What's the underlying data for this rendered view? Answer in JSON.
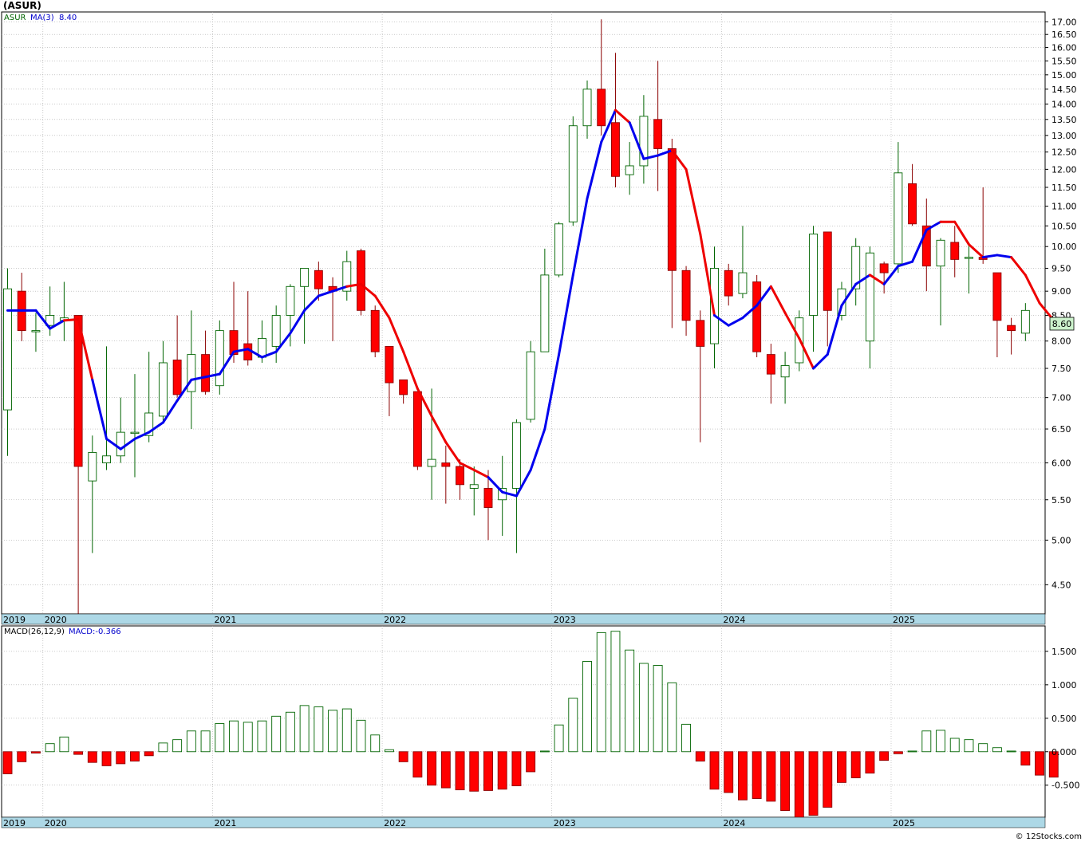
{
  "title": "(ASUR)",
  "watermark": "© 12Stocks.com",
  "price_panel": {
    "legend_symbol": "ASUR",
    "legend_ma_label": "MA(3)",
    "legend_ma_value": "8.40",
    "last_price": "8.60",
    "y_ticks": [
      "17.00",
      "16.50",
      "16.00",
      "15.50",
      "15.00",
      "14.50",
      "14.00",
      "13.50",
      "13.00",
      "12.50",
      "12.00",
      "11.50",
      "11.00",
      "10.50",
      "10.00",
      "9.50",
      "9.00",
      "8.50",
      "8.00",
      "7.50",
      "7.00",
      "6.50",
      "6.00",
      "5.50",
      "5.00",
      "4.50"
    ]
  },
  "macd_panel": {
    "legend_label": "MACD(26,12,9)",
    "legend_value": "MACD:-0.366",
    "y_ticks": [
      "1.500",
      "1.000",
      "0.500",
      "0.000",
      "-0.500"
    ]
  },
  "x_axis_labels": [
    "2019",
    "2020",
    "2021",
    "2022",
    "2023",
    "2024",
    "2025"
  ],
  "colors": {
    "up_candle": "#ffffff",
    "up_outline": "#006400",
    "down_candle": "#ff0000",
    "ma_up": "#0000ee",
    "ma_down": "#ee0000",
    "axis_band": "#add8e6",
    "grid": "#aaaaaa"
  },
  "chart_data": [
    {
      "type": "candlestick",
      "title": "(ASUR)",
      "period": "monthly",
      "scale": "log",
      "ylim": [
        4.2,
        17.4
      ],
      "start": "2019-10",
      "candles": [
        {
          "date": "2019-10",
          "o": 6.8,
          "h": 9.5,
          "l": 6.1,
          "c": 9.05
        },
        {
          "date": "2019-11",
          "o": 9.0,
          "h": 9.4,
          "l": 8.0,
          "c": 8.2
        },
        {
          "date": "2019-12",
          "o": 8.2,
          "h": 8.55,
          "l": 7.8,
          "c": 8.2
        },
        {
          "date": "2020-01",
          "o": 8.3,
          "h": 9.1,
          "l": 8.1,
          "c": 8.5
        },
        {
          "date": "2020-02",
          "o": 8.4,
          "h": 9.2,
          "l": 8.0,
          "c": 8.45
        },
        {
          "date": "2020-03",
          "o": 8.5,
          "h": 8.5,
          "l": 4.15,
          "c": 5.95
        },
        {
          "date": "2020-04",
          "o": 5.75,
          "h": 6.4,
          "l": 4.85,
          "c": 6.15
        },
        {
          "date": "2020-05",
          "o": 6.0,
          "h": 7.9,
          "l": 5.9,
          "c": 6.1
        },
        {
          "date": "2020-06",
          "o": 6.1,
          "h": 7.0,
          "l": 6.0,
          "c": 6.45
        },
        {
          "date": "2020-07",
          "o": 6.45,
          "h": 7.4,
          "l": 5.8,
          "c": 6.45
        },
        {
          "date": "2020-08",
          "o": 6.4,
          "h": 7.8,
          "l": 6.3,
          "c": 6.75
        },
        {
          "date": "2020-09",
          "o": 6.7,
          "h": 8.0,
          "l": 6.6,
          "c": 7.6
        },
        {
          "date": "2020-10",
          "o": 7.65,
          "h": 8.5,
          "l": 7.0,
          "c": 7.05
        },
        {
          "date": "2020-11",
          "o": 7.1,
          "h": 8.6,
          "l": 6.5,
          "c": 7.75
        },
        {
          "date": "2020-12",
          "o": 7.75,
          "h": 8.2,
          "l": 7.05,
          "c": 7.1
        },
        {
          "date": "2021-01",
          "o": 7.2,
          "h": 8.4,
          "l": 7.05,
          "c": 8.2
        },
        {
          "date": "2021-02",
          "o": 8.2,
          "h": 9.2,
          "l": 7.6,
          "c": 7.75
        },
        {
          "date": "2021-03",
          "o": 7.95,
          "h": 9.0,
          "l": 7.55,
          "c": 7.65
        },
        {
          "date": "2021-04",
          "o": 7.7,
          "h": 8.4,
          "l": 7.6,
          "c": 8.05
        },
        {
          "date": "2021-05",
          "o": 7.9,
          "h": 8.7,
          "l": 7.6,
          "c": 8.5
        },
        {
          "date": "2021-06",
          "o": 8.5,
          "h": 9.15,
          "l": 7.9,
          "c": 9.1
        },
        {
          "date": "2021-07",
          "o": 9.1,
          "h": 9.5,
          "l": 7.95,
          "c": 9.5
        },
        {
          "date": "2021-08",
          "o": 9.45,
          "h": 9.65,
          "l": 8.8,
          "c": 9.05
        },
        {
          "date": "2021-09",
          "o": 9.1,
          "h": 9.3,
          "l": 8.0,
          "c": 9.0
        },
        {
          "date": "2021-10",
          "o": 9.0,
          "h": 9.9,
          "l": 8.8,
          "c": 9.65
        },
        {
          "date": "2021-11",
          "o": 9.9,
          "h": 9.95,
          "l": 8.5,
          "c": 8.6
        },
        {
          "date": "2021-12",
          "o": 8.6,
          "h": 8.7,
          "l": 7.7,
          "c": 7.8
        },
        {
          "date": "2022-01",
          "o": 7.9,
          "h": 7.9,
          "l": 6.7,
          "c": 7.25
        },
        {
          "date": "2022-02",
          "o": 7.3,
          "h": 7.3,
          "l": 6.9,
          "c": 7.05
        },
        {
          "date": "2022-03",
          "o": 7.1,
          "h": 7.1,
          "l": 5.9,
          "c": 5.95
        },
        {
          "date": "2022-04",
          "o": 5.95,
          "h": 7.15,
          "l": 5.5,
          "c": 6.05
        },
        {
          "date": "2022-05",
          "o": 6.0,
          "h": 6.25,
          "l": 5.45,
          "c": 5.95
        },
        {
          "date": "2022-06",
          "o": 5.95,
          "h": 6.05,
          "l": 5.5,
          "c": 5.7
        },
        {
          "date": "2022-07",
          "o": 5.65,
          "h": 5.95,
          "l": 5.3,
          "c": 5.7
        },
        {
          "date": "2022-08",
          "o": 5.65,
          "h": 5.9,
          "l": 5.0,
          "c": 5.4
        },
        {
          "date": "2022-09",
          "o": 5.5,
          "h": 6.1,
          "l": 5.05,
          "c": 5.65
        },
        {
          "date": "2022-10",
          "o": 5.65,
          "h": 6.65,
          "l": 4.85,
          "c": 6.6
        },
        {
          "date": "2022-11",
          "o": 6.65,
          "h": 8.0,
          "l": 6.6,
          "c": 7.8
        },
        {
          "date": "2022-12",
          "o": 7.8,
          "h": 9.95,
          "l": 7.8,
          "c": 9.35
        },
        {
          "date": "2023-01",
          "o": 9.35,
          "h": 10.6,
          "l": 9.3,
          "c": 10.55
        },
        {
          "date": "2023-02",
          "o": 10.6,
          "h": 13.6,
          "l": 10.5,
          "c": 13.3
        },
        {
          "date": "2023-03",
          "o": 13.3,
          "h": 14.8,
          "l": 12.9,
          "c": 14.5
        },
        {
          "date": "2023-04",
          "o": 14.5,
          "h": 17.1,
          "l": 13.0,
          "c": 13.3
        },
        {
          "date": "2023-05",
          "o": 13.4,
          "h": 15.8,
          "l": 11.5,
          "c": 11.8
        },
        {
          "date": "2023-06",
          "o": 11.85,
          "h": 12.8,
          "l": 11.3,
          "c": 12.1
        },
        {
          "date": "2023-07",
          "o": 12.1,
          "h": 14.3,
          "l": 11.6,
          "c": 13.6
        },
        {
          "date": "2023-08",
          "o": 13.5,
          "h": 15.5,
          "l": 11.4,
          "c": 12.6
        },
        {
          "date": "2023-09",
          "o": 12.6,
          "h": 12.9,
          "l": 8.25,
          "c": 9.45
        },
        {
          "date": "2023-10",
          "o": 9.45,
          "h": 9.55,
          "l": 8.1,
          "c": 8.4
        },
        {
          "date": "2023-11",
          "o": 8.4,
          "h": 8.6,
          "l": 6.3,
          "c": 7.9
        },
        {
          "date": "2023-12",
          "o": 7.95,
          "h": 10.0,
          "l": 7.5,
          "c": 9.5
        },
        {
          "date": "2024-01",
          "o": 9.45,
          "h": 9.6,
          "l": 8.7,
          "c": 8.9
        },
        {
          "date": "2024-02",
          "o": 8.95,
          "h": 10.5,
          "l": 8.85,
          "c": 9.4
        },
        {
          "date": "2024-03",
          "o": 9.2,
          "h": 9.35,
          "l": 7.7,
          "c": 7.8
        },
        {
          "date": "2024-04",
          "o": 7.75,
          "h": 7.95,
          "l": 6.9,
          "c": 7.4
        },
        {
          "date": "2024-05",
          "o": 7.35,
          "h": 7.8,
          "l": 6.9,
          "c": 7.55
        },
        {
          "date": "2024-06",
          "o": 7.6,
          "h": 8.6,
          "l": 7.45,
          "c": 8.45
        },
        {
          "date": "2024-07",
          "o": 8.5,
          "h": 10.5,
          "l": 7.8,
          "c": 10.3
        },
        {
          "date": "2024-08",
          "o": 10.35,
          "h": 10.35,
          "l": 7.9,
          "c": 8.6
        },
        {
          "date": "2024-09",
          "o": 8.5,
          "h": 9.2,
          "l": 8.4,
          "c": 9.05
        },
        {
          "date": "2024-10",
          "o": 9.05,
          "h": 10.2,
          "l": 8.7,
          "c": 10.0
        },
        {
          "date": "2024-11",
          "o": 8.0,
          "h": 10.0,
          "l": 7.5,
          "c": 9.85
        },
        {
          "date": "2024-12",
          "o": 9.6,
          "h": 9.65,
          "l": 8.95,
          "c": 9.4
        },
        {
          "date": "2025-01",
          "o": 9.6,
          "h": 12.8,
          "l": 9.4,
          "c": 11.9
        },
        {
          "date": "2025-02",
          "o": 11.6,
          "h": 12.15,
          "l": 10.5,
          "c": 10.55
        },
        {
          "date": "2025-03",
          "o": 10.5,
          "h": 11.2,
          "l": 9.0,
          "c": 9.55
        },
        {
          "date": "2025-04",
          "o": 9.55,
          "h": 10.2,
          "l": 8.3,
          "c": 10.15
        },
        {
          "date": "2025-05",
          "o": 10.1,
          "h": 10.5,
          "l": 9.3,
          "c": 9.7
        },
        {
          "date": "2025-06",
          "o": 9.75,
          "h": 10.1,
          "l": 8.95,
          "c": 9.75
        },
        {
          "date": "2025-07",
          "o": 9.75,
          "h": 11.5,
          "l": 9.6,
          "c": 9.7
        },
        {
          "date": "2025-08",
          "o": 9.4,
          "h": 9.4,
          "l": 7.7,
          "c": 8.4
        },
        {
          "date": "2025-09",
          "o": 8.3,
          "h": 8.45,
          "l": 7.75,
          "c": 8.2
        },
        {
          "date": "2025-10",
          "o": 8.15,
          "h": 8.75,
          "l": 8.0,
          "c": 8.6
        }
      ],
      "ma": [
        8.6,
        8.6,
        8.6,
        8.24,
        8.4,
        8.42,
        7.3,
        6.35,
        6.2,
        6.35,
        6.45,
        6.6,
        6.95,
        7.3,
        7.35,
        7.4,
        7.8,
        7.85,
        7.7,
        7.8,
        8.15,
        8.6,
        8.9,
        9.0,
        9.1,
        9.15,
        8.9,
        8.45,
        7.8,
        7.15,
        6.7,
        6.3,
        6.0,
        5.9,
        5.8,
        5.6,
        5.55,
        5.9,
        6.5,
        7.75,
        9.35,
        11.2,
        12.8,
        13.8,
        13.4,
        12.3,
        12.4,
        12.55,
        12.0,
        10.3,
        8.5,
        8.3,
        8.45,
        8.7,
        9.1,
        8.55,
        8.05,
        7.5,
        7.75,
        8.7,
        9.15,
        9.35,
        9.15,
        9.55,
        9.65,
        10.4,
        10.6,
        10.6,
        10.05,
        9.75,
        9.8,
        9.75,
        9.35,
        8.75,
        8.4
      ],
      "ma_color": [
        "up",
        "up",
        "up",
        "up",
        "up",
        "down",
        "down",
        "up",
        "up",
        "up",
        "up",
        "up",
        "up",
        "up",
        "up",
        "up",
        "up",
        "up",
        "up",
        "up",
        "up",
        "up",
        "up",
        "up",
        "up",
        "down",
        "down",
        "down",
        "down",
        "down",
        "down",
        "down",
        "down",
        "down",
        "down",
        "up",
        "up",
        "up",
        "up",
        "up",
        "up",
        "up",
        "up",
        "up",
        "down",
        "up",
        "up",
        "up",
        "down",
        "down",
        "down",
        "up",
        "up",
        "up",
        "up",
        "down",
        "down",
        "down",
        "up",
        "up",
        "up",
        "up",
        "down",
        "up",
        "up",
        "up",
        "up",
        "down",
        "down",
        "down",
        "up",
        "up",
        "down",
        "down",
        "down"
      ]
    },
    {
      "type": "bar",
      "title": "MACD(26,12,9)",
      "ylim": [
        -0.98,
        1.88
      ],
      "values": [
        -0.33,
        -0.15,
        -0.02,
        0.12,
        0.22,
        -0.04,
        -0.16,
        -0.21,
        -0.18,
        -0.14,
        -0.06,
        0.13,
        0.18,
        0.31,
        0.31,
        0.42,
        0.46,
        0.44,
        0.46,
        0.53,
        0.59,
        0.69,
        0.67,
        0.62,
        0.64,
        0.47,
        0.25,
        0.03,
        -0.15,
        -0.38,
        -0.5,
        -0.54,
        -0.57,
        -0.59,
        -0.58,
        -0.56,
        -0.51,
        -0.3,
        0.01,
        0.4,
        0.8,
        1.35,
        1.78,
        1.8,
        1.52,
        1.32,
        1.29,
        1.03,
        0.41,
        -0.14,
        -0.56,
        -0.61,
        -0.72,
        -0.7,
        -0.74,
        -0.88,
        -0.98,
        -0.95,
        -0.83,
        -0.46,
        -0.39,
        -0.32,
        -0.13,
        -0.03,
        0.01,
        0.31,
        0.32,
        0.2,
        0.18,
        0.12,
        0.06,
        0.01,
        -0.2,
        -0.35,
        -0.38
      ]
    }
  ]
}
